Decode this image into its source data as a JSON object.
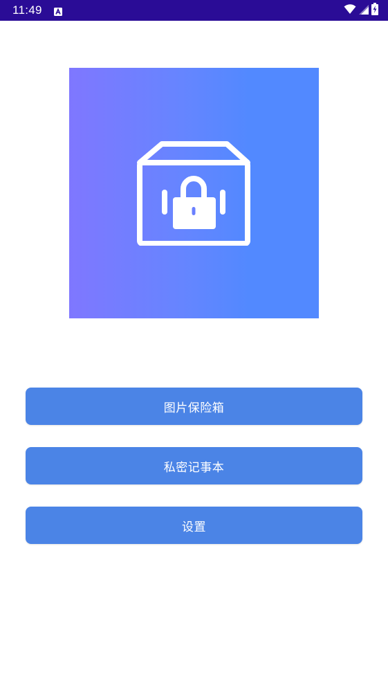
{
  "status_bar": {
    "time": "11:49",
    "background": "#2a0c96",
    "notification_icon": "a-badge-icon",
    "icons": [
      "wifi-icon",
      "cell-signal-icon",
      "battery-charging-icon"
    ]
  },
  "hero": {
    "icon": "locked-box-icon",
    "gradient": [
      "#7f77ff",
      "#5289ff"
    ]
  },
  "menu": {
    "button_color": "#4b84e6",
    "items": [
      {
        "label": "图片保险箱"
      },
      {
        "label": "私密记事本"
      },
      {
        "label": "设置"
      }
    ]
  }
}
